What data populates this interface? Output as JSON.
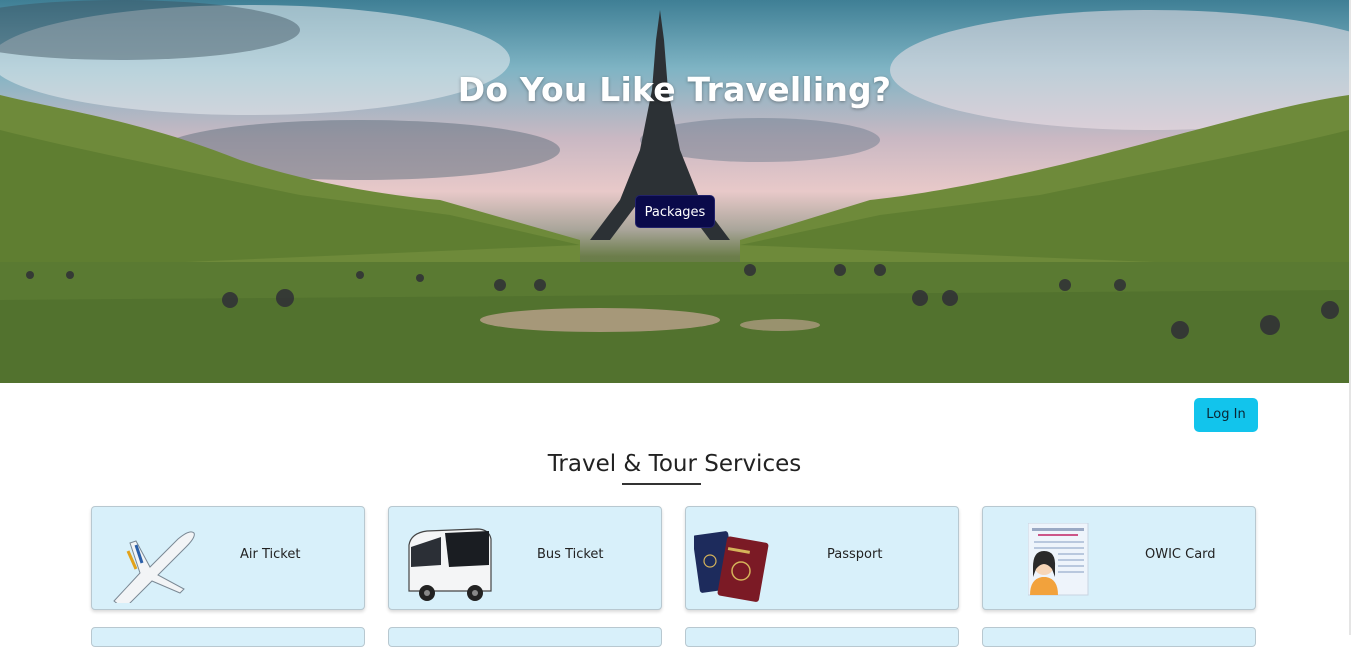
{
  "hero": {
    "title": "Do You Like Travelling?",
    "packages_label": "Packages"
  },
  "login_label": "Log In",
  "section": {
    "title": "Travel & Tour Services"
  },
  "services": [
    {
      "label": "Air Ticket",
      "icon": "airplane-icon"
    },
    {
      "label": "Bus Ticket",
      "icon": "bus-icon"
    },
    {
      "label": "Passport",
      "icon": "passport-icon"
    },
    {
      "label": "OWIC Card",
      "icon": "id-card-icon"
    }
  ],
  "colors": {
    "packages_button": "#0a0a4a",
    "login_button": "#12c4ec",
    "card_background": "#d8f0fa"
  }
}
